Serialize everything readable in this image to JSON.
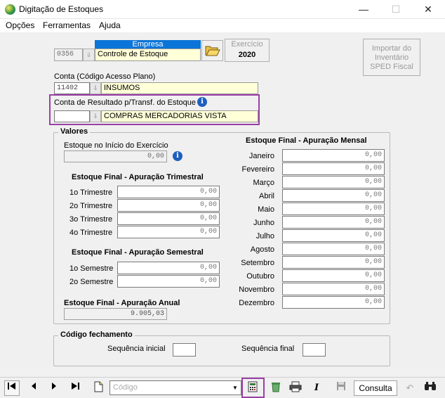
{
  "window": {
    "title": "Digitação de Estoques",
    "minimize": "—",
    "maximize": "☐",
    "close": "✕"
  },
  "menu": [
    {
      "label": "Opções"
    },
    {
      "label": "Ferramentas"
    },
    {
      "label": "Ajuda"
    }
  ],
  "empresa": {
    "header": "Empresa",
    "code": "0356",
    "name": "Controle de Estoque"
  },
  "exercicio": {
    "label": "Exercício",
    "value": "2020"
  },
  "importar": {
    "label": "Importar do Inventário SPED Fiscal"
  },
  "conta": {
    "label": "Conta (Código Acesso Plano)",
    "code": "11402",
    "name": "INSUMOS"
  },
  "conta_resultado": {
    "label": "Conta de Resultado p/Transf. do Estoque",
    "code": "",
    "name": "COMPRAS MERCADORIAS VISTA"
  },
  "valores": {
    "title": "Valores",
    "inicio_label": "Estoque no Início do Exercício",
    "inicio_value": "0,00",
    "trimestral_title": "Estoque Final - Apuração Trimestral",
    "trimestral": [
      {
        "label": "1o Trimestre",
        "value": "0,00"
      },
      {
        "label": "2o Trimestre",
        "value": "0,00"
      },
      {
        "label": "3o Trimestre",
        "value": "0,00"
      },
      {
        "label": "4o Trimestre",
        "value": "0,00"
      }
    ],
    "semestral_title": "Estoque Final - Apuração Semestral",
    "semestral": [
      {
        "label": "1o Semestre",
        "value": "0,00"
      },
      {
        "label": "2o Semestre",
        "value": "0,00"
      }
    ],
    "anual_title": "Estoque Final - Apuração Anual",
    "anual_value": "9.905,03",
    "mensal_title": "Estoque Final - Apuração Mensal",
    "mensal": [
      {
        "label": "Janeiro",
        "value": "0,00"
      },
      {
        "label": "Fevereiro",
        "value": "0,00"
      },
      {
        "label": "Março",
        "value": "0,00"
      },
      {
        "label": "Abril",
        "value": "0,00"
      },
      {
        "label": "Maio",
        "value": "0,00"
      },
      {
        "label": "Junho",
        "value": "0,00"
      },
      {
        "label": "Julho",
        "value": "0,00"
      },
      {
        "label": "Agosto",
        "value": "0,00"
      },
      {
        "label": "Setembro",
        "value": "0,00"
      },
      {
        "label": "Outubro",
        "value": "0,00"
      },
      {
        "label": "Novembro",
        "value": "0,00"
      },
      {
        "label": "Dezembro",
        "value": "0,00"
      }
    ]
  },
  "fechamento": {
    "title": "Código fechamento",
    "seq_inicial_label": "Sequência inicial",
    "seq_inicial": "",
    "seq_final_label": "Sequência final",
    "seq_final": ""
  },
  "toolbar": {
    "search_placeholder": "Código",
    "mode_label": "Consulta"
  },
  "colors": {
    "highlight": "#9b3fa6",
    "empresa_header": "#0a74d8",
    "yellow_field": "#ffffd8"
  },
  "icons": [
    "first-record-icon",
    "prev-record-icon",
    "next-record-icon",
    "last-record-icon",
    "new-document-icon",
    "calculator-icon",
    "recycle-icon",
    "printer-icon",
    "italic-icon",
    "save-icon",
    "undo-icon",
    "binoculars-icon",
    "folder-open-icon",
    "info-icon",
    "app-globe-icon"
  ]
}
